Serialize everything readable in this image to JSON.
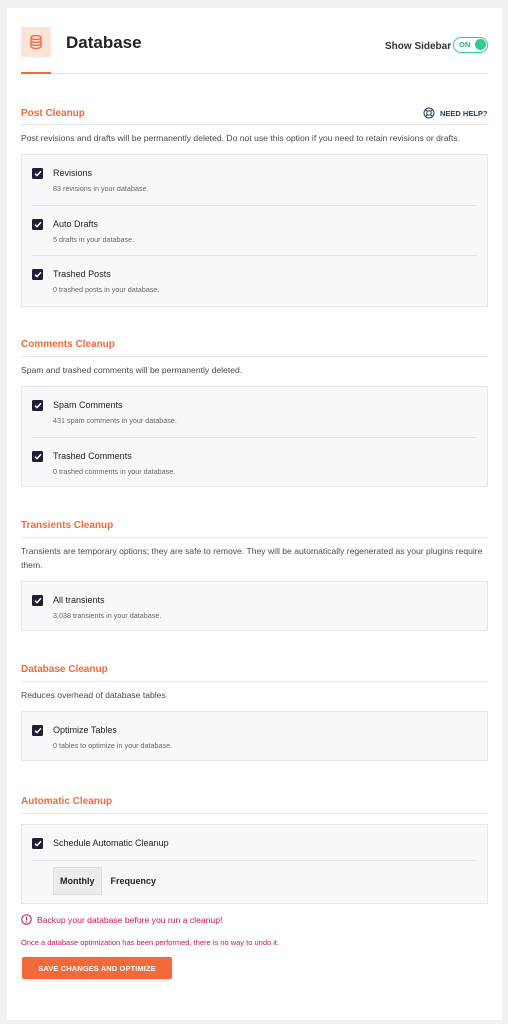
{
  "header": {
    "title": "Database",
    "show_sidebar_label": "Show Sidebar",
    "toggle_text": "ON"
  },
  "need_help": "NEED HELP?",
  "sections": {
    "post": {
      "title": "Post Cleanup",
      "desc": "Post revisions and drafts will be permanently deleted. Do not use this option if you need to retain revisions or drafts.",
      "items": [
        {
          "label": "Revisions",
          "sub": "83 revisions in your database.",
          "checked": true
        },
        {
          "label": "Auto Drafts",
          "sub": "5 drafts in your database.",
          "checked": true
        },
        {
          "label": "Trashed Posts",
          "sub": "0 trashed posts in your database.",
          "checked": true
        }
      ]
    },
    "comments": {
      "title": "Comments Cleanup",
      "desc": "Spam and trashed comments will be permanently deleted.",
      "items": [
        {
          "label": "Spam Comments",
          "sub": "431 spam comments in your database.",
          "checked": true
        },
        {
          "label": "Trashed Comments",
          "sub": "0 trashed comments in your database.",
          "checked": true
        }
      ]
    },
    "transients": {
      "title": "Transients Cleanup",
      "desc": "Transients are temporary options; they are safe to remove. They will be automatically regenerated as your plugins require them.",
      "items": [
        {
          "label": "All transients",
          "sub": "3,038 transients in your database.",
          "checked": true
        }
      ]
    },
    "database": {
      "title": "Database Cleanup",
      "desc": "Reduces overhead of database tables",
      "items": [
        {
          "label": "Optimize Tables",
          "sub": "0 tables to optimize in your database.",
          "checked": true
        }
      ]
    },
    "automatic": {
      "title": "Automatic Cleanup",
      "items": [
        {
          "label": "Schedule Automatic Cleanup",
          "checked": true
        }
      ],
      "frequency_value": "Monthly",
      "frequency_label": "Frequency"
    }
  },
  "warning": "Backup your database before you run a cleanup!",
  "note": "Once a database optimization has been performed, there is no way to undo it.",
  "save_button": "SAVE CHANGES AND OPTIMIZE",
  "colors": {
    "accent": "#f26a3b",
    "toggle_on": "#2ecc8f",
    "checkbox": "#1e1f33",
    "warning": "#c8174a"
  }
}
